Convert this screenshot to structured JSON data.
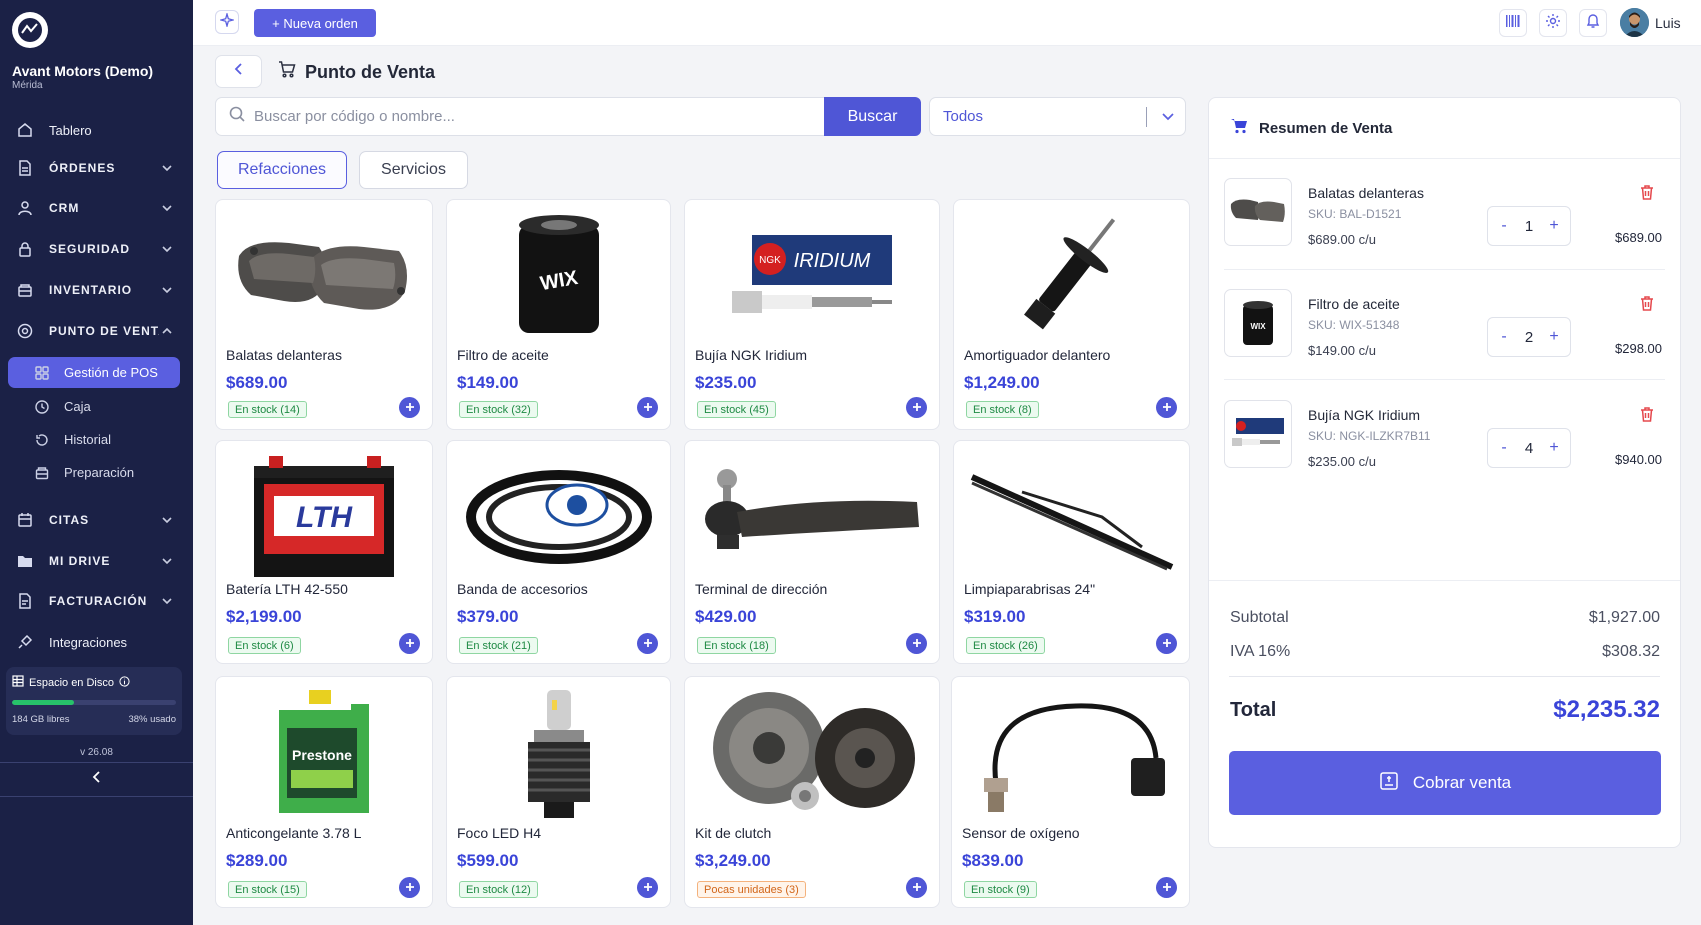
{
  "sidebar": {
    "company": "Avant Motors (Demo)",
    "city": "Mérida",
    "items": [
      {
        "label": "Tablero",
        "icon": "home-icon"
      },
      {
        "label": "ÓRDENES",
        "icon": "document-icon"
      },
      {
        "label": "CRM",
        "icon": "user-icon"
      },
      {
        "label": "SEGURIDAD",
        "icon": "lock-icon"
      },
      {
        "label": "INVENTARIO",
        "icon": "box-icon"
      },
      {
        "label": "PUNTO DE VENTA",
        "icon": "pos-icon"
      },
      {
        "label": "CITAS",
        "icon": "calendar-icon"
      },
      {
        "label": "MI DRIVE",
        "icon": "folder-icon"
      },
      {
        "label": "FACTURACIÓN",
        "icon": "invoice-icon"
      },
      {
        "label": "Integraciones",
        "icon": "plug-icon"
      }
    ],
    "sub_items": [
      {
        "label": "Gestión de POS",
        "icon": "grid-icon"
      },
      {
        "label": "Caja",
        "icon": "clock-icon"
      },
      {
        "label": "Historial",
        "icon": "history-icon"
      },
      {
        "label": "Preparación",
        "icon": "box-icon"
      }
    ],
    "disk": {
      "title": "Espacio en Disco",
      "free": "184 GB libres",
      "used": "38% usado",
      "used_fraction": 0.38
    },
    "version": "v 26.08"
  },
  "topbar": {
    "new_order": "+ Nueva orden",
    "user": "Luis"
  },
  "page": {
    "title": "Punto de Venta"
  },
  "search": {
    "placeholder": "Buscar por código o nombre...",
    "button": "Buscar",
    "filter_value": "Todos"
  },
  "tabs": [
    "Refacciones",
    "Servicios"
  ],
  "products": [
    {
      "name": "Balatas delanteras",
      "price": "$689.00",
      "stock": "En stock (14)",
      "low": false
    },
    {
      "name": "Filtro de aceite",
      "price": "$149.00",
      "stock": "En stock (32)",
      "low": false
    },
    {
      "name": "Bujía NGK Iridium",
      "price": "$235.00",
      "stock": "En stock (45)",
      "low": false
    },
    {
      "name": "Amortiguador delantero",
      "price": "$1,249.00",
      "stock": "En stock (8)",
      "low": false
    },
    {
      "name": "Batería LTH 42-550",
      "price": "$2,199.00",
      "stock": "En stock (6)",
      "low": false
    },
    {
      "name": "Banda de accesorios",
      "price": "$379.00",
      "stock": "En stock (21)",
      "low": false
    },
    {
      "name": "Terminal de dirección",
      "price": "$429.00",
      "stock": "En stock (18)",
      "low": false
    },
    {
      "name": "Limpiaparabrisas 24\"",
      "price": "$319.00",
      "stock": "En stock (26)",
      "low": false
    },
    {
      "name": "Anticongelante 3.78 L",
      "price": "$289.00",
      "stock": "En stock (15)",
      "low": false
    },
    {
      "name": "Foco LED H4",
      "price": "$599.00",
      "stock": "En stock (12)",
      "low": false
    },
    {
      "name": "Kit de clutch",
      "price": "$3,249.00",
      "stock": "Pocas unidades (3)",
      "low": true
    },
    {
      "name": "Sensor de oxígeno",
      "price": "$839.00",
      "stock": "En stock (9)",
      "low": false
    }
  ],
  "summary": {
    "title": "Resumen de Venta",
    "items": [
      {
        "name": "Balatas delanteras",
        "sku": "SKU: BAL-D1521",
        "unit": "$689.00 c/u",
        "qty": "1",
        "total": "$689.00"
      },
      {
        "name": "Filtro de aceite",
        "sku": "SKU: WIX-51348",
        "unit": "$149.00 c/u",
        "qty": "2",
        "total": "$298.00"
      },
      {
        "name": "Bujía NGK Iridium",
        "sku": "SKU: NGK-ILZKR7B11",
        "unit": "$235.00 c/u",
        "qty": "4",
        "total": "$940.00"
      }
    ],
    "subtotal_label": "Subtotal",
    "subtotal": "$1,927.00",
    "tax_label": "IVA 16%",
    "tax": "$308.32",
    "total_label": "Total",
    "total": "$2,235.32",
    "pay_button": "Cobrar venta"
  },
  "colors": {
    "accent": "#5a5fe0",
    "sidebar": "#1b2146",
    "price": "#3a44d8",
    "stock_ok": "#1f8a44",
    "stock_low": "#d2661a"
  }
}
